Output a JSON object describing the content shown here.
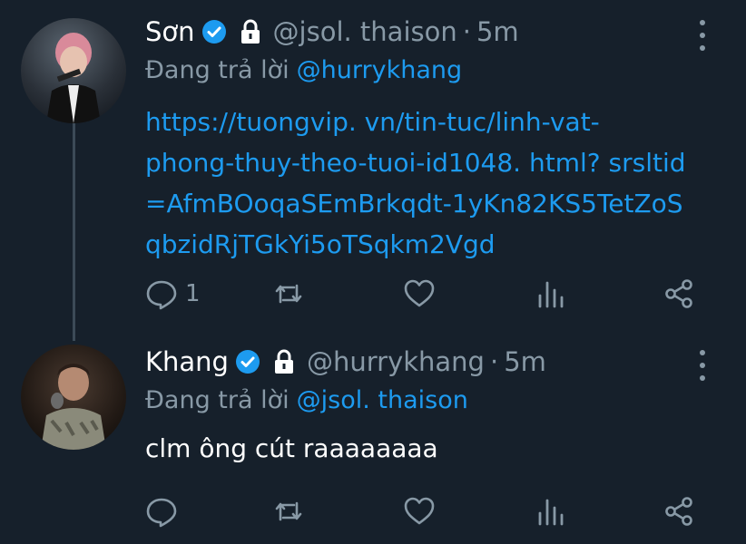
{
  "tweets": [
    {
      "name": "Sơn",
      "handle": "@jsol. thaison",
      "time": "5m",
      "reply_prefix": "Đang trả lời",
      "reply_to": "@hurrykhang",
      "link_lines": [
        "https://tuongvip. vn/tin-tuc/linh-vat-",
        "phong-thuy-theo-tuoi-id1048. html? srsltid",
        "=AfmBOoqaSEmBrkqdt-1yKn82KS5TetZoS",
        "qbzidRjTGkYi5oTSqkm2Vgd"
      ],
      "reply_count": "1"
    },
    {
      "name": "Khang",
      "handle": "@hurrykhang",
      "time": "5m",
      "reply_prefix": "Đang trả lời",
      "reply_to": "@jsol. thaison",
      "text": "clm ông cút raaaaaaaa"
    }
  ],
  "separator": "·",
  "icons": [
    "verified-badge-icon",
    "lock-icon",
    "more-options-icon",
    "reply-icon",
    "retweet-icon",
    "like-icon",
    "stats-icon",
    "share-icon"
  ],
  "colors": {
    "background": "#16202b",
    "accent": "#1d9bf0",
    "muted": "#8899a6",
    "text": "#ffffff"
  }
}
